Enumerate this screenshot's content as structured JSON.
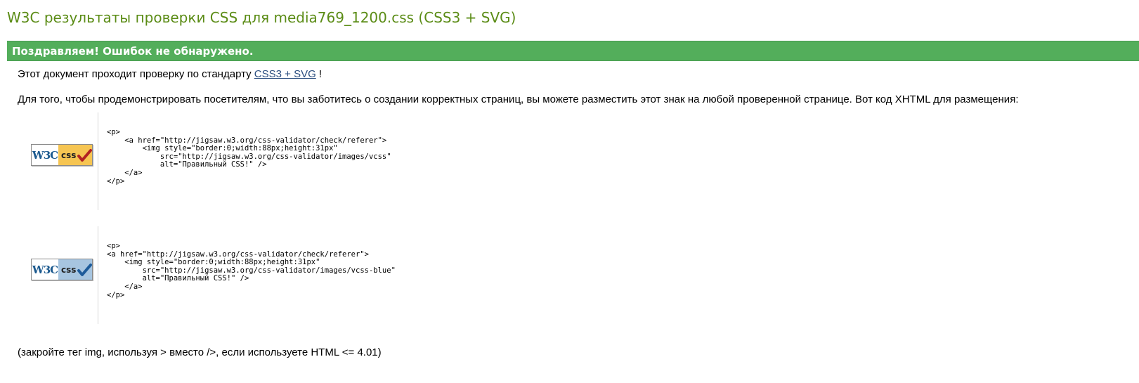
{
  "header": {
    "title": "W3C результаты проверки CSS для media769_1200.css (CSS3 + SVG)"
  },
  "status": {
    "congrats": "Поздравляем! Ошибок не обнаружено."
  },
  "main": {
    "conformance_prefix": "Этот документ проходит проверку по стандарту",
    "conformance_link": "CSS3 + SVG",
    "conformance_suffix": " !",
    "badge_intro": "Для того, чтобы продемонстрировать посетителям, что вы заботитесь о создании корректных страниц, вы можете разместить этот знак на любой проверенной странице. Вот код XHTML для размещения:",
    "badges": [
      {
        "w3c_text": "W3C",
        "css_text": "css",
        "check_color": "#b22222",
        "code": "<p>\n    <a href=\"http://jigsaw.w3.org/css-validator/check/referer\">\n        <img style=\"border:0;width:88px;height:31px\"\n            src=\"http://jigsaw.w3.org/css-validator/images/vcss\"\n            alt=\"Правильный CSS!\" />\n    </a>\n</p>"
      },
      {
        "w3c_text": "W3C",
        "css_text": "css",
        "check_color": "#1d5b9a",
        "code": "<p>\n<a href=\"http://jigsaw.w3.org/css-validator/check/referer\">\n    <img style=\"border:0;width:88px;height:31px\"\n        src=\"http://jigsaw.w3.org/css-validator/images/vcss-blue\"\n        alt=\"Правильный CSS!\" />\n    </a>\n</p>"
      }
    ],
    "footnote": "(закройте тег img, используя > вместо />, если используете HTML <= 4.01)"
  },
  "colors": {
    "title": "#5b8c16",
    "congrats_bg": "#53ae5b",
    "link": "#2a4d7f"
  }
}
